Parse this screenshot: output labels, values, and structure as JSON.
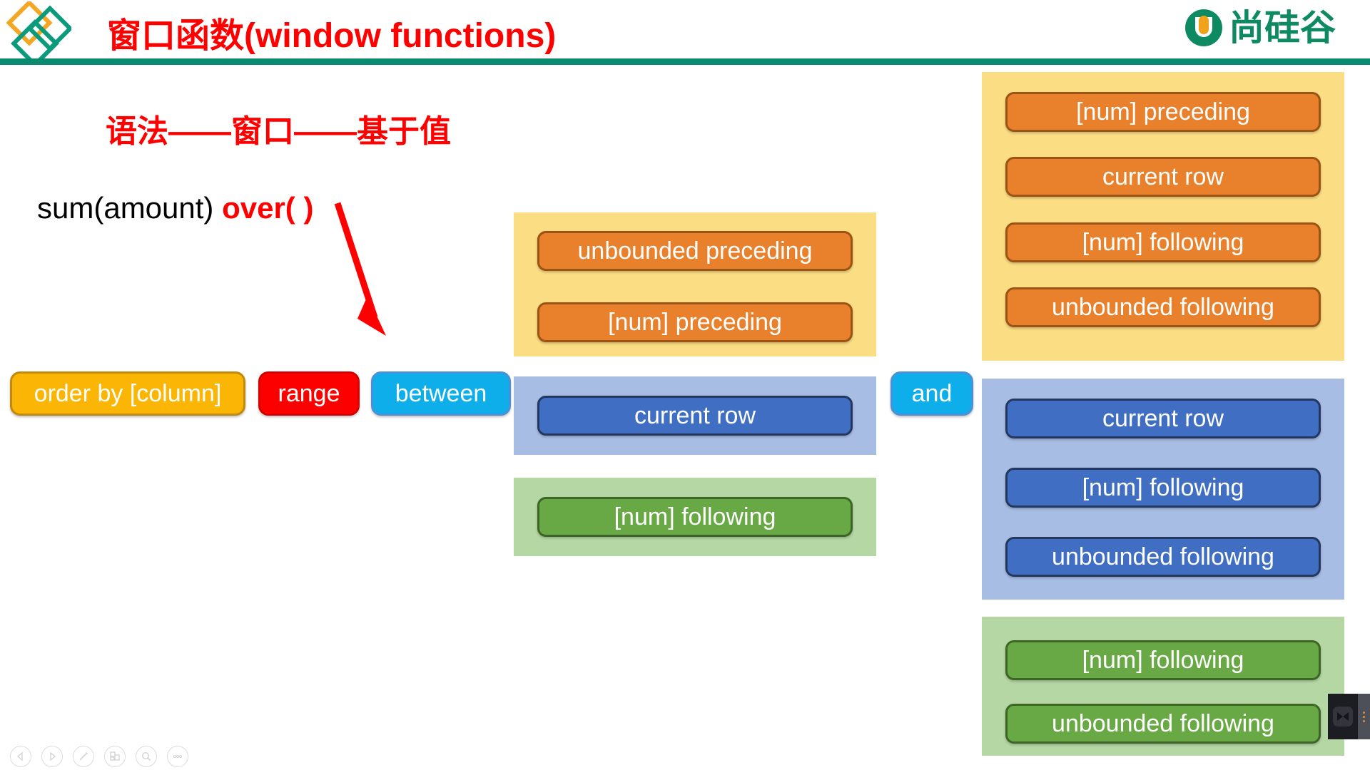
{
  "header": {
    "title": "窗口函数(window functions)",
    "logo_icon": "diamonds-logo",
    "brand_name": "尚硅谷",
    "brand_icon": "atguigu-u-logo",
    "rule_color": "#0a8a6e",
    "title_color": "#ff0000"
  },
  "body": {
    "subtitle": "语法——窗口——基于值",
    "code_prefix": "sum(amount) ",
    "code_over": "over( )",
    "arrow_icon": "red-down-arrow",
    "arrow_color": "#ff0000"
  },
  "chips": {
    "order_by": {
      "label": "order by [column]",
      "bg": "#fbb504",
      "border": "#c18a0a"
    },
    "range": {
      "label": "range",
      "bg": "#fc0000",
      "border": "#d60000"
    },
    "between": {
      "label": "between",
      "bg": "#0eaeea",
      "border": "#4a90d9"
    },
    "and": {
      "label": "and",
      "bg": "#0eaeea",
      "border": "#4a90d9"
    }
  },
  "middle_column": {
    "panels": [
      {
        "name": "preceding-group",
        "panel_color": "#fbdd83",
        "item_color": "#e8802c",
        "items": [
          {
            "label": "unbounded preceding"
          },
          {
            "label": "[num] preceding"
          }
        ]
      },
      {
        "name": "current-row-group",
        "panel_color": "#a7bde4",
        "item_color": "#3f6ec2",
        "items": [
          {
            "label": "current row"
          }
        ]
      },
      {
        "name": "following-group",
        "panel_color": "#b5d7a3",
        "item_color": "#68a845",
        "items": [
          {
            "label": "[num] following"
          }
        ]
      }
    ]
  },
  "right_column": {
    "panels": [
      {
        "name": "upper-bound-from-preceding",
        "panel_color": "#fbdd83",
        "item_color": "#e8802c",
        "items": [
          {
            "label": "[num] preceding"
          },
          {
            "label": "current row"
          },
          {
            "label": "[num] following"
          },
          {
            "label": "unbounded following"
          }
        ]
      },
      {
        "name": "upper-bound-from-current-row",
        "panel_color": "#a7bde4",
        "item_color": "#3f6ec2",
        "items": [
          {
            "label": "current row"
          },
          {
            "label": "[num] following"
          },
          {
            "label": "unbounded following"
          }
        ]
      },
      {
        "name": "upper-bound-from-following",
        "panel_color": "#b5d7a3",
        "item_color": "#68a845",
        "items": [
          {
            "label": "[num] following"
          },
          {
            "label": "unbounded following"
          }
        ]
      }
    ]
  },
  "toolbar": {
    "buttons": [
      {
        "name": "previous-slide-icon",
        "icon": "triangle-left"
      },
      {
        "name": "next-slide-icon",
        "icon": "triangle-right"
      },
      {
        "name": "pen-icon",
        "icon": "pen"
      },
      {
        "name": "slide-grid-icon",
        "icon": "grid"
      },
      {
        "name": "zoom-icon",
        "icon": "magnifier"
      },
      {
        "name": "more-options-icon",
        "icon": "ellipsis"
      }
    ]
  },
  "recorder": {
    "name": "screen-recorder-widget",
    "icon": "bowtie-record-icon",
    "menu_icon": "vertical-dots-icon",
    "bg": "#1c1d22",
    "accent": "#e08b3a"
  }
}
